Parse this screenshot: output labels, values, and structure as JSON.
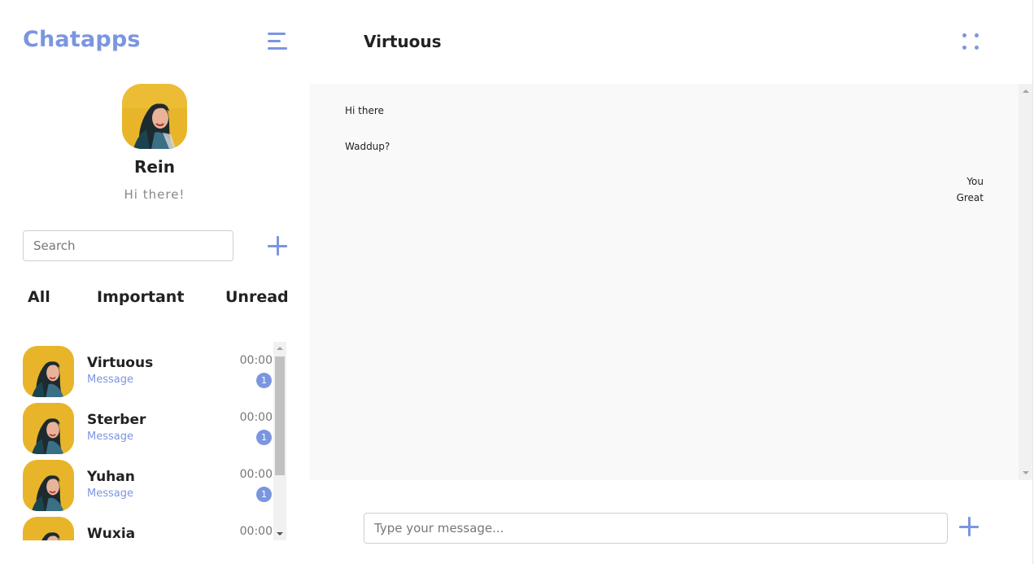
{
  "sidebar": {
    "brand": "Chatapps",
    "profile": {
      "name": "Rein",
      "status": "Hi there!"
    },
    "search": {
      "placeholder": "Search"
    },
    "tabs": [
      "All",
      "Important",
      "Unread"
    ],
    "contacts": [
      {
        "name": "Virtuous",
        "preview": "Message",
        "time": "00:00",
        "unread": "1"
      },
      {
        "name": "Sterber",
        "preview": "Message",
        "time": "00:00",
        "unread": "1"
      },
      {
        "name": "Yuhan",
        "preview": "Message",
        "time": "00:00",
        "unread": "1"
      },
      {
        "name": "Wuxia",
        "preview": "",
        "time": "00:00",
        "unread": ""
      }
    ]
  },
  "chat": {
    "title": "Virtuous",
    "messages": [
      {
        "side": "left",
        "text": "Hi there"
      },
      {
        "side": "left",
        "text": "Waddup?"
      },
      {
        "side": "right",
        "sender": "You",
        "text": "Great"
      }
    ],
    "input": {
      "placeholder": "Type your message..."
    }
  },
  "colors": {
    "accent": "#7b96e0",
    "chat_bg": "#f9f9f9",
    "avatar_bg": "#e8b52a"
  },
  "icons": [
    "menu-icon",
    "plus-icon",
    "dots-grid-icon"
  ]
}
